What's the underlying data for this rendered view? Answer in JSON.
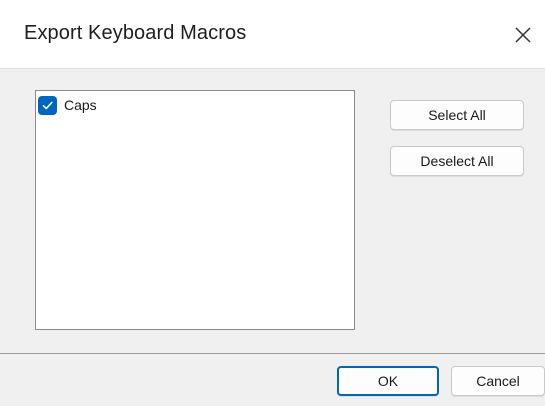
{
  "window": {
    "title": "Export Keyboard Macros"
  },
  "macros": {
    "items": [
      {
        "label": "Caps",
        "checked": true
      }
    ]
  },
  "buttons": {
    "select_all": "Select All",
    "deselect_all": "Deselect All",
    "ok": "OK",
    "cancel": "Cancel"
  },
  "icons": {
    "close": "close-icon",
    "check": "checkmark-icon"
  },
  "colors": {
    "accent": "#0067c0",
    "title_bar": "#ffffff",
    "body": "#f0f0f0"
  }
}
